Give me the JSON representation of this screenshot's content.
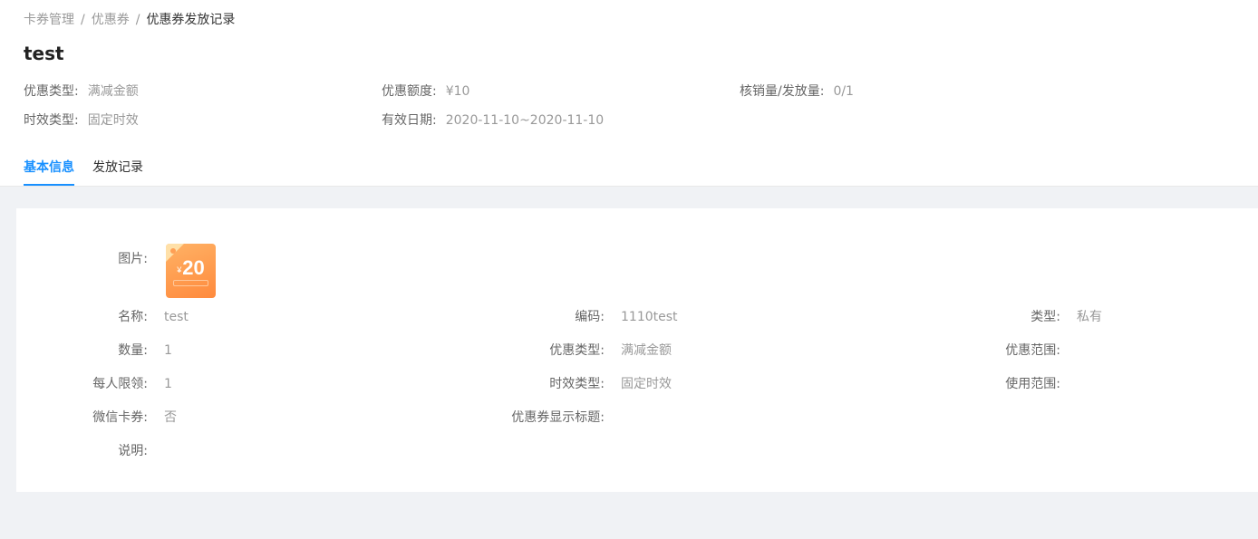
{
  "breadcrumb": [
    "卡券管理",
    "优惠券",
    "优惠券发放记录"
  ],
  "page_title": "test",
  "summary": {
    "discount_type": {
      "label": "优惠类型:",
      "value": "满减金额"
    },
    "discount_amount": {
      "label": "优惠额度:",
      "value": "¥10"
    },
    "redeem_issue": {
      "label": "核销量/发放量:",
      "value": "0/1"
    },
    "validity_type": {
      "label": "时效类型:",
      "value": "固定时效"
    },
    "valid_date": {
      "label": "有效日期:",
      "value": "2020-11-10~2020-11-10"
    }
  },
  "tabs": [
    {
      "label": "基本信息",
      "active": true
    },
    {
      "label": "发放记录",
      "active": false
    }
  ],
  "colors": {
    "accent": "#1890ff",
    "coupon_orange": "#ff8a3d"
  },
  "detail": {
    "image": {
      "label": "图片:",
      "icon": "coupon-image",
      "amount": "20",
      "currency": "¥"
    },
    "name": {
      "label": "名称:",
      "value": "test"
    },
    "code": {
      "label": "编码:",
      "value": "1110test"
    },
    "type": {
      "label": "类型:",
      "value": "私有"
    },
    "quantity": {
      "label": "数量:",
      "value": "1"
    },
    "discount_type": {
      "label": "优惠类型:",
      "value": "满减金额"
    },
    "discount_scope": {
      "label": "优惠范围:",
      "value": ""
    },
    "per_person_limit": {
      "label": "每人限领:",
      "value": "1"
    },
    "validity_type": {
      "label": "时效类型:",
      "value": "固定时效"
    },
    "usage_scope": {
      "label": "使用范围:",
      "value": ""
    },
    "wechat_card": {
      "label": "微信卡券:",
      "value": "否"
    },
    "display_title": {
      "label": "优惠券显示标题:",
      "value": ""
    },
    "description": {
      "label": "说明:",
      "value": ""
    }
  }
}
